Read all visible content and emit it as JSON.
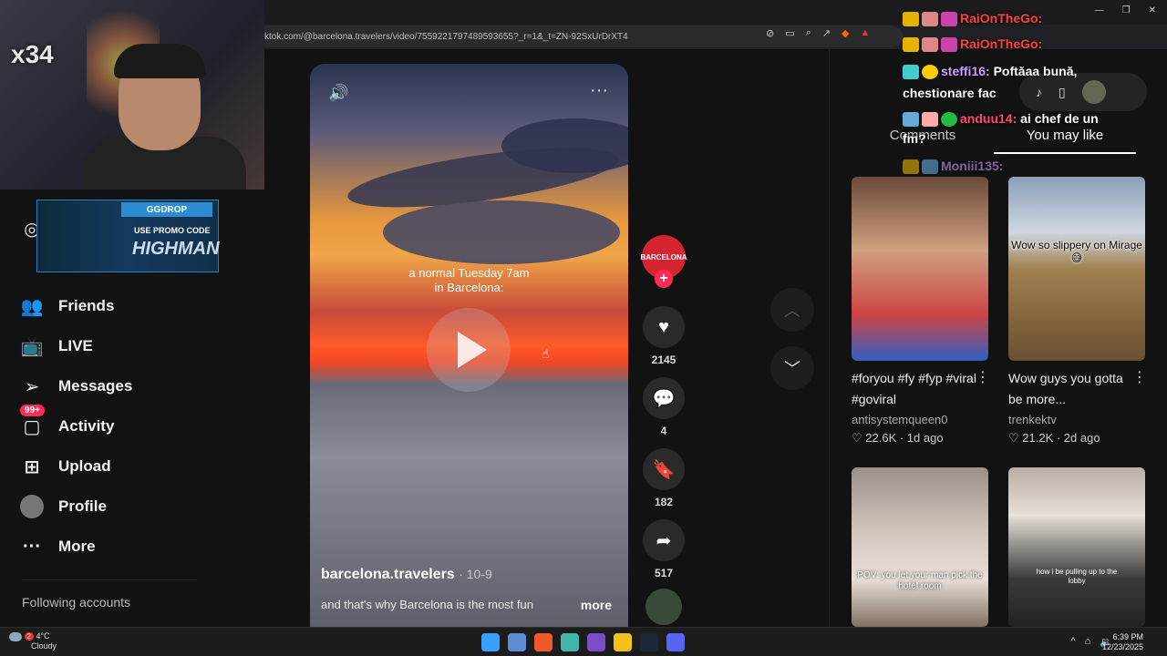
{
  "browser": {
    "url": "ktok.com/@barcelona.travelers/video/7559221797489593655?_r=1&_t=ZN-92SxUrDrXT4"
  },
  "overlay": {
    "multiplier": "x34",
    "promo_brand": "GGDROP",
    "promo_line": "USE PROMO CODE",
    "promo_code": "HIGHMAN"
  },
  "sidebar": {
    "items": [
      {
        "label": "Friends",
        "icon": "friends-icon"
      },
      {
        "label": "LIVE",
        "icon": "live-icon"
      },
      {
        "label": "Messages",
        "icon": "messages-icon"
      },
      {
        "label": "Activity",
        "icon": "activity-icon",
        "badge": "99+"
      },
      {
        "label": "Upload",
        "icon": "upload-icon"
      },
      {
        "label": "Profile",
        "icon": "profile-avatar"
      },
      {
        "label": "More",
        "icon": "more-icon"
      }
    ],
    "following_header": "Following accounts"
  },
  "video": {
    "caption_line1": "a normal Tuesday 7am",
    "caption_line2": "in Barcelona:",
    "author": "barcelona.travelers",
    "date": "· 10-9",
    "description": "and that's why Barcelona is the most fun",
    "more_label": "more",
    "avatar_text": "BARCELONA"
  },
  "actions": {
    "likes": "2145",
    "comments": "4",
    "saves": "182",
    "shares": "517"
  },
  "right_panel": {
    "tabs": [
      "Comments",
      "You may like"
    ],
    "active_tab": "You may like",
    "cards": [
      {
        "title": "#foryou #fy #fyp #viral #goviral",
        "user": "antisystemqueen0",
        "stats": "♡ 22.6K · 1d ago"
      },
      {
        "title": "Wow guys you gotta be more...",
        "user": "trenkektv",
        "stats": "♡ 21.2K · 2d ago",
        "thumb_caption": "Wow so slippery on Mirage😅"
      },
      {
        "thumb_caption": "POV: you let your man pick the hotel room"
      },
      {
        "thumb_caption": "how i be pulling up to the lobby"
      }
    ]
  },
  "chat": {
    "lines": [
      {
        "user": "RaiOnTheGo:",
        "text": ""
      },
      {
        "user": "RaiOnTheGo:",
        "text": ""
      },
      {
        "user": "steffi16:",
        "text": "Poftăaa bună,"
      },
      {
        "user": "",
        "text": "chestionare fac"
      },
      {
        "user": "anduu14:",
        "text": "ai chef de un"
      },
      {
        "user": "",
        "text": "fm?"
      },
      {
        "user": "Moniii135:",
        "text": ""
      }
    ]
  },
  "taskbar": {
    "weather_temp": "4°C",
    "weather_desc": "Cloudy",
    "weather_badge": "2",
    "time": "6:39 PM",
    "date": "12/23/2025"
  },
  "colors": {
    "accent": "#fe2c55",
    "page_bg": "#121212",
    "chat_user": "#c9a0ff"
  }
}
